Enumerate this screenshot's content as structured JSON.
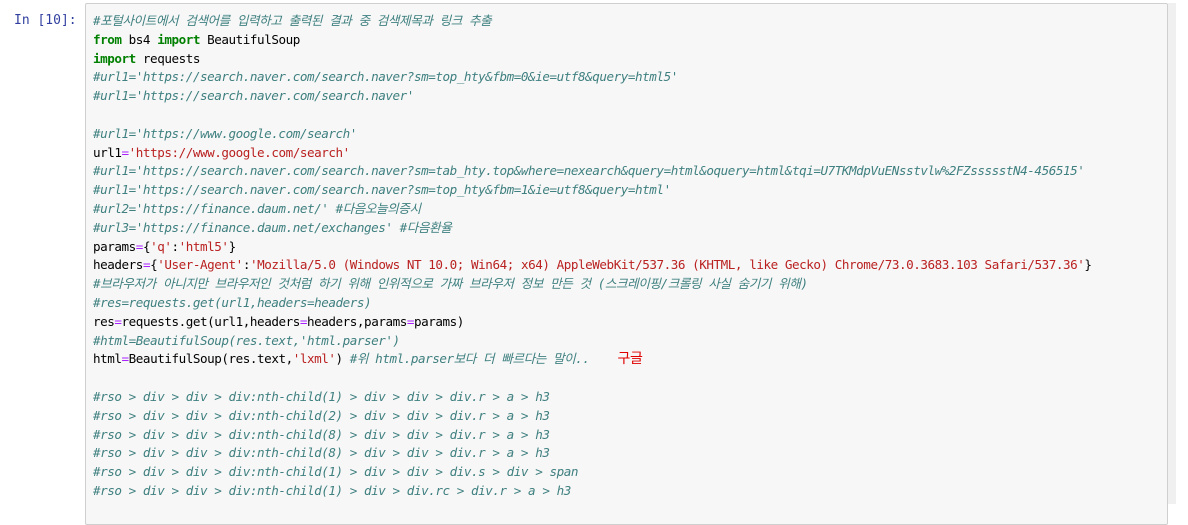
{
  "cell": {
    "prompt": "In [10]:",
    "lines": [
      [
        {
          "t": "cm",
          "v": "#포털사이트에서 검색어를 입력하고 출력된 결과 중 검색제목과 링크 추출"
        }
      ],
      [
        {
          "t": "kw",
          "v": "from"
        },
        {
          "t": "nm",
          "v": " bs4 "
        },
        {
          "t": "kw",
          "v": "import"
        },
        {
          "t": "nm",
          "v": " BeautifulSoup"
        }
      ],
      [
        {
          "t": "kw",
          "v": "import"
        },
        {
          "t": "nm",
          "v": " requests"
        }
      ],
      [
        {
          "t": "cm",
          "v": "#url1='https://search.naver.com/search.naver?sm=top_hty&fbm=0&ie=utf8&query=html5'"
        }
      ],
      [
        {
          "t": "cm",
          "v": "#url1='https://search.naver.com/search.naver'"
        }
      ],
      [],
      [
        {
          "t": "cm",
          "v": "#url1='https://www.google.com/search'"
        }
      ],
      [
        {
          "t": "nm",
          "v": "url1"
        },
        {
          "t": "op",
          "v": "="
        },
        {
          "t": "st",
          "v": "'https://www.google.com/search'"
        }
      ],
      [
        {
          "t": "cm",
          "v": "#url1='https://search.naver.com/search.naver?sm=tab_hty.top&where=nexearch&query=html&oquery=html&tqi=U7TKMdpVuENsstvlw%2FZssssstN4-456515'"
        }
      ],
      [
        {
          "t": "cm",
          "v": "#url1='https://search.naver.com/search.naver?sm=top_hty&fbm=1&ie=utf8&query=html'"
        }
      ],
      [
        {
          "t": "cm",
          "v": "#url2='https://finance.daum.net/' #다음오늘의증시"
        }
      ],
      [
        {
          "t": "cm",
          "v": "#url3='https://finance.daum.net/exchanges' #다음환율"
        }
      ],
      [
        {
          "t": "nm",
          "v": "params"
        },
        {
          "t": "op",
          "v": "="
        },
        {
          "t": "nm",
          "v": "{"
        },
        {
          "t": "st",
          "v": "'q'"
        },
        {
          "t": "nm",
          "v": ":"
        },
        {
          "t": "st",
          "v": "'html5'"
        },
        {
          "t": "nm",
          "v": "}"
        }
      ],
      [
        {
          "t": "nm",
          "v": "headers"
        },
        {
          "t": "op",
          "v": "="
        },
        {
          "t": "nm",
          "v": "{"
        },
        {
          "t": "st",
          "v": "'User-Agent'"
        },
        {
          "t": "nm",
          "v": ":"
        },
        {
          "t": "st",
          "v": "'Mozilla/5.0 (Windows NT 10.0; Win64; x64) AppleWebKit/537.36 (KHTML, like Gecko) Chrome/73.0.3683.103 Safari/537.36'"
        },
        {
          "t": "nm",
          "v": "}"
        }
      ],
      [
        {
          "t": "cm",
          "v": "#브라우저가 아니지만 브라우저인 것처럼 하기 위해 인위적으로 가짜 브라우저 정보 만든 것 (스크레이핑/크롤링 사실 숨기기 위해)"
        }
      ],
      [
        {
          "t": "cm",
          "v": "#res=requests.get(url1,headers=headers)"
        }
      ],
      [
        {
          "t": "nm",
          "v": "res"
        },
        {
          "t": "op",
          "v": "="
        },
        {
          "t": "nm",
          "v": "requests.get(url1,headers"
        },
        {
          "t": "op",
          "v": "="
        },
        {
          "t": "nm",
          "v": "headers,params"
        },
        {
          "t": "op",
          "v": "="
        },
        {
          "t": "nm",
          "v": "params)"
        }
      ],
      [
        {
          "t": "cm",
          "v": "#html=BeautifulSoup(res.text,'html.parser')"
        }
      ],
      [
        {
          "t": "nm",
          "v": "html"
        },
        {
          "t": "op",
          "v": "="
        },
        {
          "t": "nm",
          "v": "BeautifulSoup(res.text,"
        },
        {
          "t": "st",
          "v": "'lxml'"
        },
        {
          "t": "nm",
          "v": ") "
        },
        {
          "t": "cm",
          "v": "#위 html.parser보다 더 빠르다는 말이.."
        },
        {
          "t": "annot",
          "v": "구글"
        }
      ],
      [],
      [
        {
          "t": "cm",
          "v": "#rso > div > div > div:nth-child(1) > div > div > div.r > a > h3"
        }
      ],
      [
        {
          "t": "cm",
          "v": "#rso > div > div > div:nth-child(2) > div > div > div.r > a > h3"
        }
      ],
      [
        {
          "t": "cm",
          "v": "#rso > div > div > div:nth-child(8) > div > div > div.r > a > h3"
        }
      ],
      [
        {
          "t": "cm",
          "v": "#rso > div > div > div:nth-child(8) > div > div > div.r > a > h3"
        }
      ],
      [
        {
          "t": "cm",
          "v": "#rso > div > div > div:nth-child(1) > div > div > div.s > div > span"
        }
      ],
      [
        {
          "t": "cm",
          "v": "#rso > div > div > div:nth-child(1) > div > div.rc > div.r > a > h3"
        }
      ]
    ]
  },
  "colors": {
    "comment": "#408080",
    "keyword": "#008000",
    "string": "#ba2121",
    "operator": "#aa22ff",
    "annotation": "#e00000",
    "prompt": "#303f9f"
  }
}
